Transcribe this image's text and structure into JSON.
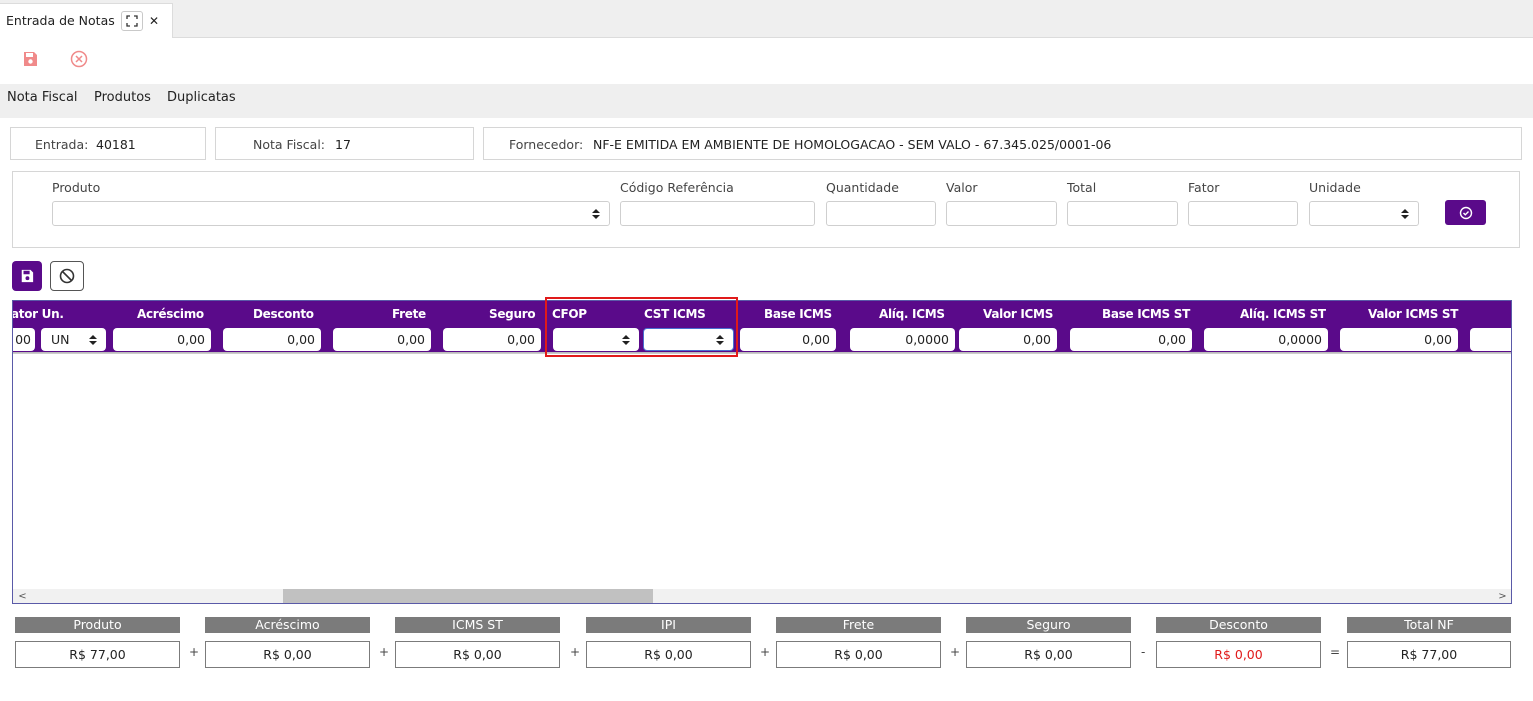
{
  "tab": {
    "title": "Entrada de Notas"
  },
  "toolbar": {
    "save_icon": "save-icon",
    "cancel_icon": "cancel-circle-icon",
    "icon_color": "#f08a8a"
  },
  "menu": {
    "items": [
      "Nota Fiscal",
      "Produtos",
      "Duplicatas"
    ]
  },
  "info": {
    "entrada_label": "Entrada:",
    "entrada_value": "40181",
    "nota_label": "Nota Fiscal:",
    "nota_value": "17",
    "fornecedor_label": "Fornecedor:",
    "fornecedor_value": "NF-E EMITIDA EM AMBIENTE DE HOMOLOGACAO - SEM VALO - 67.345.025/0001-06"
  },
  "form": {
    "produto_label": "Produto",
    "codigo_label": "Código Referência",
    "quantidade_label": "Quantidade",
    "valor_label": "Valor",
    "total_label": "Total",
    "fator_label": "Fator",
    "unidade_label": "Unidade",
    "produto_value": "",
    "codigo_value": "",
    "quantidade_value": "",
    "valor_value": "",
    "total_value": "",
    "fator_value": "",
    "unidade_value": ""
  },
  "grid": {
    "headers": [
      "ator Un.",
      "Acréscimo",
      "Desconto",
      "Frete",
      "Seguro",
      "CFOP",
      "CST ICMS",
      "Base ICMS",
      "Alíq. ICMS",
      "Valor ICMS",
      "Base ICMS ST",
      "Alíq. ICMS ST",
      "Valor ICMS ST"
    ],
    "row": {
      "fator": "00",
      "un": "UN",
      "acrescimo": "0,00",
      "desconto": "0,00",
      "frete": "0,00",
      "seguro": "0,00",
      "cfop": "",
      "cst_icms": "",
      "base_icms": "0,00",
      "aliq_icms": "0,0000",
      "valor_icms": "0,00",
      "base_icms_st": "0,00",
      "aliq_icms_st": "0,0000",
      "valor_icms_st": "0,00"
    },
    "header_color": "#5a0a8a"
  },
  "totals": {
    "labels": [
      "Produto",
      "Acréscimo",
      "ICMS ST",
      "IPI",
      "Frete",
      "Seguro",
      "Desconto",
      "Total NF"
    ],
    "values": [
      "R$ 77,00",
      "R$ 0,00",
      "R$ 0,00",
      "R$ 0,00",
      "R$ 0,00",
      "R$ 0,00",
      "R$ 0,00",
      "R$ 77,00"
    ],
    "operators": [
      "+",
      "+",
      "+",
      "+",
      "+",
      "-",
      "="
    ],
    "discount_color": "#e01a1a"
  }
}
